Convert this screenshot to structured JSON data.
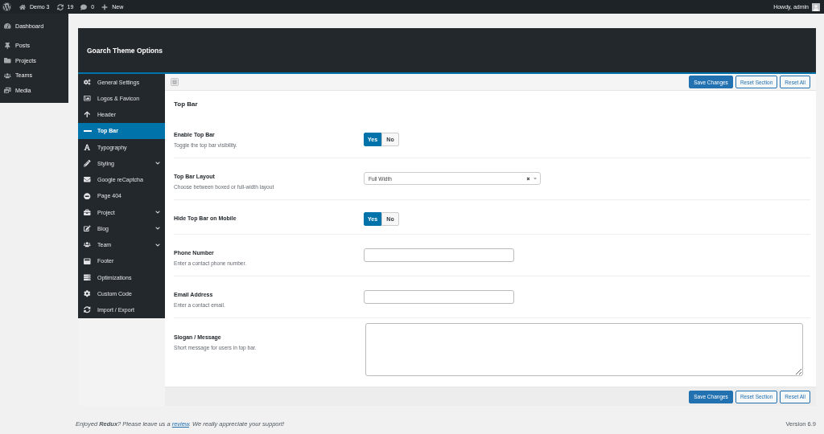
{
  "admin_bar": {
    "items": [
      {
        "label": "Demo 3"
      },
      {
        "label": "19"
      },
      {
        "label": "0"
      },
      {
        "label": "New"
      }
    ],
    "greeting": "Howdy, admin"
  },
  "admin_menu": {
    "items": [
      {
        "label": "Dashboard"
      },
      {
        "label": "Posts"
      },
      {
        "label": "Projects"
      },
      {
        "label": "Teams"
      },
      {
        "label": "Media"
      }
    ]
  },
  "panel": {
    "title": "Goarch Theme Options",
    "sidebar": {
      "items": [
        {
          "label": "General Settings",
          "selected": false,
          "has_submenu": false
        },
        {
          "label": "Logos & Favicon",
          "selected": false,
          "has_submenu": false
        },
        {
          "label": "Header",
          "selected": false,
          "has_submenu": false
        },
        {
          "label": "Top Bar",
          "selected": true,
          "has_submenu": false
        },
        {
          "label": "Typography",
          "selected": false,
          "has_submenu": false
        },
        {
          "label": "Styling",
          "selected": false,
          "has_submenu": true
        },
        {
          "label": "Google reCaptcha",
          "selected": false,
          "has_submenu": false
        },
        {
          "label": "Page 404",
          "selected": false,
          "has_submenu": false
        },
        {
          "label": "Project",
          "selected": false,
          "has_submenu": true
        },
        {
          "label": "Blog",
          "selected": false,
          "has_submenu": true
        },
        {
          "label": "Team",
          "selected": false,
          "has_submenu": true
        },
        {
          "label": "Footer",
          "selected": false,
          "has_submenu": false
        },
        {
          "label": "Optimizations",
          "selected": false,
          "has_submenu": false
        },
        {
          "label": "Custom Code",
          "selected": false,
          "has_submenu": false
        },
        {
          "label": "Import / Export",
          "selected": false,
          "has_submenu": false
        }
      ]
    },
    "toolbar": {
      "buttons": [
        {
          "label": "Save Changes",
          "kind": "primary"
        },
        {
          "label": "Reset Section",
          "kind": "secondary"
        },
        {
          "label": "Reset All",
          "kind": "secondary"
        }
      ]
    },
    "section": {
      "title": "Top Bar",
      "fields": [
        {
          "kind": "switch",
          "label": "Enable Top Bar",
          "description": "Toggle the top bar visibility.",
          "options": [
            {
              "label": "Yes",
              "selected": true
            },
            {
              "label": "No",
              "selected": false
            }
          ]
        },
        {
          "kind": "select",
          "label": "Top Bar Layout",
          "description": "Choose between boxed or full-width layout",
          "value": "Full Width"
        },
        {
          "kind": "switch",
          "label": "Hide Top Bar on Mobile",
          "options": [
            {
              "label": "Yes",
              "selected": true
            },
            {
              "label": "No",
              "selected": false
            }
          ]
        },
        {
          "kind": "text",
          "label": "Phone Number",
          "description": "Enter a contact phone number."
        },
        {
          "kind": "text",
          "label": "Email Address",
          "description": "Enter a contact email."
        },
        {
          "kind": "textarea",
          "label": "Slogan / Message",
          "description": "Short message for users in top bar."
        }
      ]
    },
    "footer_bar": {
      "buttons": [
        {
          "label": "Save Changes",
          "kind": "primary"
        },
        {
          "label": "Reset Section",
          "kind": "secondary"
        },
        {
          "label": "Reset All",
          "kind": "secondary"
        }
      ]
    }
  },
  "footer": {
    "credit": {
      "before": "Enjoyed **Redux**? Please leave us a",
      "link": "review",
      "after": ". We really appreciate your support!"
    },
    "version": "Version 6.9"
  }
}
